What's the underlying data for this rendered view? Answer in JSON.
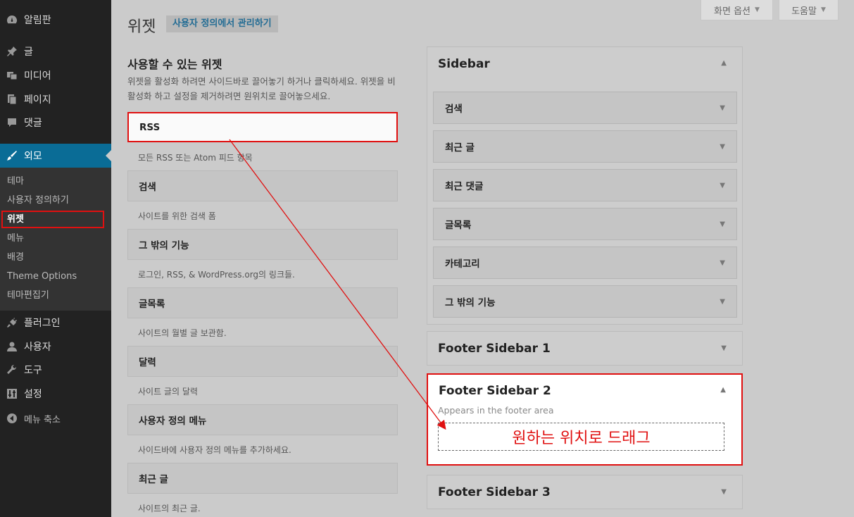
{
  "admin_menu": {
    "dashboard": "알림판",
    "posts": "글",
    "media": "미디어",
    "pages": "페이지",
    "comments": "댓글",
    "appearance": "외모",
    "submenu": [
      "테마",
      "사용자 정의하기",
      "위젯",
      "메뉴",
      "배경",
      "Theme Options",
      "테마편집기"
    ],
    "plugins": "플러그인",
    "users": "사용자",
    "tools": "도구",
    "settings": "설정",
    "collapse": "메뉴 축소"
  },
  "header": {
    "title": "위젯",
    "manage_button": "사용자 정의에서 관리하기",
    "screen_options": "화면 옵션",
    "help": "도움말"
  },
  "available": {
    "heading": "사용할 수 있는 위젯",
    "description": "위젯을 활성화 하려면 사이드바로 끌어놓기 하거나 클릭하세요. 위젯을 비활성화 하고 설정을 제거하려면 원위치로 끌어놓으세요.",
    "widgets": [
      {
        "name": "RSS",
        "desc": "모든 RSS 또는 Atom 피드 항목"
      },
      {
        "name": "검색",
        "desc": "사이트를 위한 검색 폼"
      },
      {
        "name": "그 밖의 기능",
        "desc": "로그인, RSS, & WordPress.org의 링크들."
      },
      {
        "name": "글목록",
        "desc": "사이트의 월별 글 보관함."
      },
      {
        "name": "달력",
        "desc": "사이트 글의 달력"
      },
      {
        "name": "사용자 정의 메뉴",
        "desc": "사이드바에 사용자 정의 메뉴를 추가하세요."
      },
      {
        "name": "최근 글",
        "desc": "사이트의 최근 글."
      }
    ]
  },
  "sidebars": {
    "sidebar": {
      "title": "Sidebar",
      "widgets": [
        "검색",
        "최근 글",
        "최근 댓글",
        "글목록",
        "카테고리",
        "그 밖의 기능"
      ]
    },
    "footer1": {
      "title": "Footer Sidebar 1"
    },
    "footer2": {
      "title": "Footer Sidebar 2",
      "desc": "Appears in the footer area",
      "drop_hint": "원하는 위치로 드래그"
    },
    "footer3": {
      "title": "Footer Sidebar 3"
    }
  },
  "icons": {
    "dashboard": "dashboard-icon",
    "posts": "pin-icon",
    "media": "media-icon",
    "pages": "pages-icon",
    "comments": "comment-icon",
    "appearance": "brush-icon",
    "plugins": "plugin-icon",
    "users": "user-icon",
    "tools": "wrench-icon",
    "settings": "settings-icon",
    "collapse": "collapse-icon"
  },
  "colors": {
    "accent": "#0a6c96",
    "highlight": "#e01010",
    "sidebar_bg": "#222222"
  }
}
